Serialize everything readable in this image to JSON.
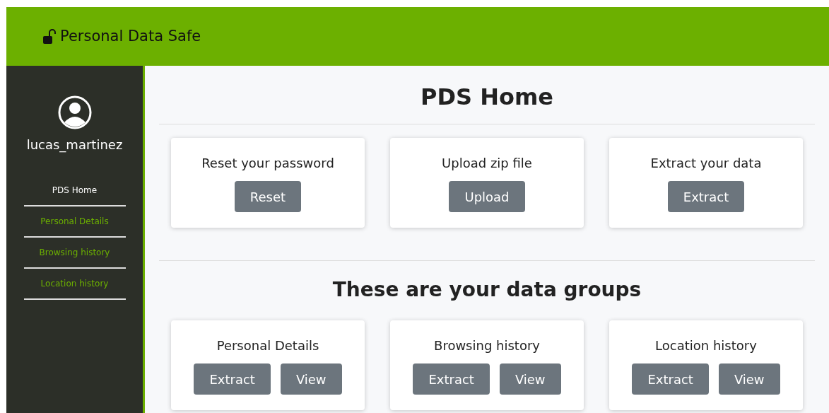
{
  "header": {
    "title": "Personal Data Safe"
  },
  "sidebar": {
    "username": "lucas_martinez",
    "items": [
      {
        "label": "PDS Home",
        "selected": true
      },
      {
        "label": "Personal Details",
        "selected": false
      },
      {
        "label": "Browsing history",
        "selected": false
      },
      {
        "label": "Location history",
        "selected": false
      }
    ]
  },
  "page_title": "PDS Home",
  "actions": [
    {
      "title": "Reset your password",
      "buttons": [
        "Reset"
      ]
    },
    {
      "title": "Upload zip file",
      "buttons": [
        "Upload"
      ]
    },
    {
      "title": "Extract your data",
      "buttons": [
        "Extract"
      ]
    }
  ],
  "groups_title": "These are your data groups",
  "groups": [
    {
      "title": "Personal Details",
      "buttons": [
        "Extract",
        "View"
      ]
    },
    {
      "title": "Browsing history",
      "buttons": [
        "Extract",
        "View"
      ]
    },
    {
      "title": "Location history",
      "buttons": [
        "Extract",
        "View"
      ]
    }
  ]
}
